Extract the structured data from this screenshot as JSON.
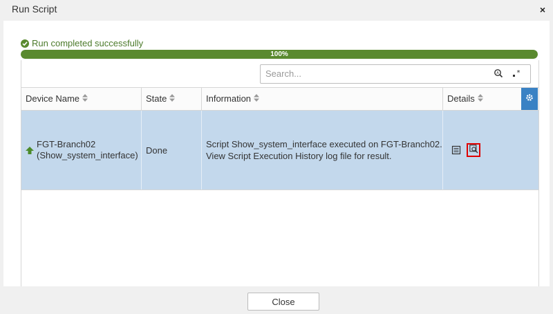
{
  "window": {
    "title": "Run Script",
    "close_glyph": "×"
  },
  "status": {
    "message": "Run completed successfully",
    "progress_percent": 100,
    "progress_label": "100%",
    "color": "#5a8a2f"
  },
  "search": {
    "placeholder": "Search..."
  },
  "table": {
    "columns": [
      "Device Name",
      "State",
      "Information",
      "Details"
    ],
    "rows": [
      {
        "device_line1": "FGT-Branch02",
        "device_line2": "(Show_system_interface)",
        "state": "Done",
        "info_line1": "Script Show_system_interface executed on FGT-Branch02.",
        "info_line2": "View Script Execution History log file for result.",
        "selected": true
      }
    ]
  },
  "footer": {
    "close_label": "Close"
  },
  "colors": {
    "accent": "#3a82c4",
    "selected_row": "#c3d8ec",
    "highlight": "#e00000"
  },
  "icons": [
    "check-circle-icon",
    "search-icon",
    "regex-icon",
    "sort-icon",
    "gear-icon",
    "arrow-up-icon",
    "log-details-icon",
    "view-log-icon"
  ]
}
